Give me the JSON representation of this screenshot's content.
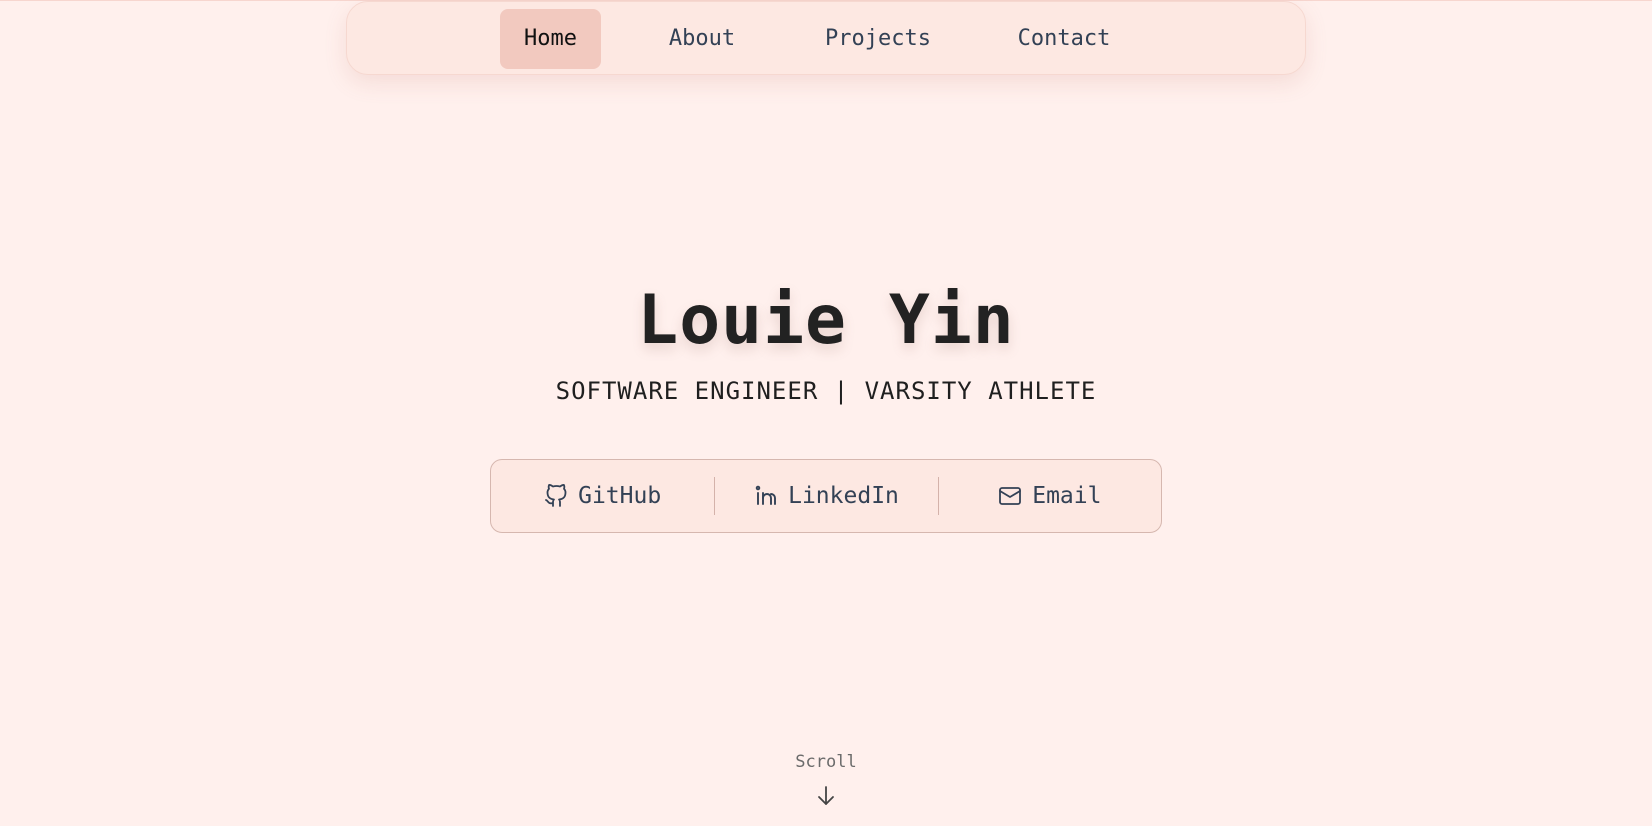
{
  "nav": {
    "items": [
      {
        "label": "Home",
        "active": true
      },
      {
        "label": "About",
        "active": false
      },
      {
        "label": "Projects",
        "active": false
      },
      {
        "label": "Contact",
        "active": false
      }
    ]
  },
  "hero": {
    "name": "Louie Yin",
    "subtitle": "SOFTWARE ENGINEER | VARSITY ATHLETE"
  },
  "links": [
    {
      "label": "GitHub",
      "icon": "github-icon"
    },
    {
      "label": "LinkedIn",
      "icon": "linkedin-icon"
    },
    {
      "label": "Email",
      "icon": "mail-icon"
    }
  ],
  "scroll": {
    "label": "Scroll",
    "icon": "arrow-down-icon"
  },
  "colors": {
    "background": "#fff0ed",
    "nav_background": "#fde8e2",
    "nav_active": "#f2c9bf",
    "text": "#222222",
    "muted_text": "#334155"
  }
}
